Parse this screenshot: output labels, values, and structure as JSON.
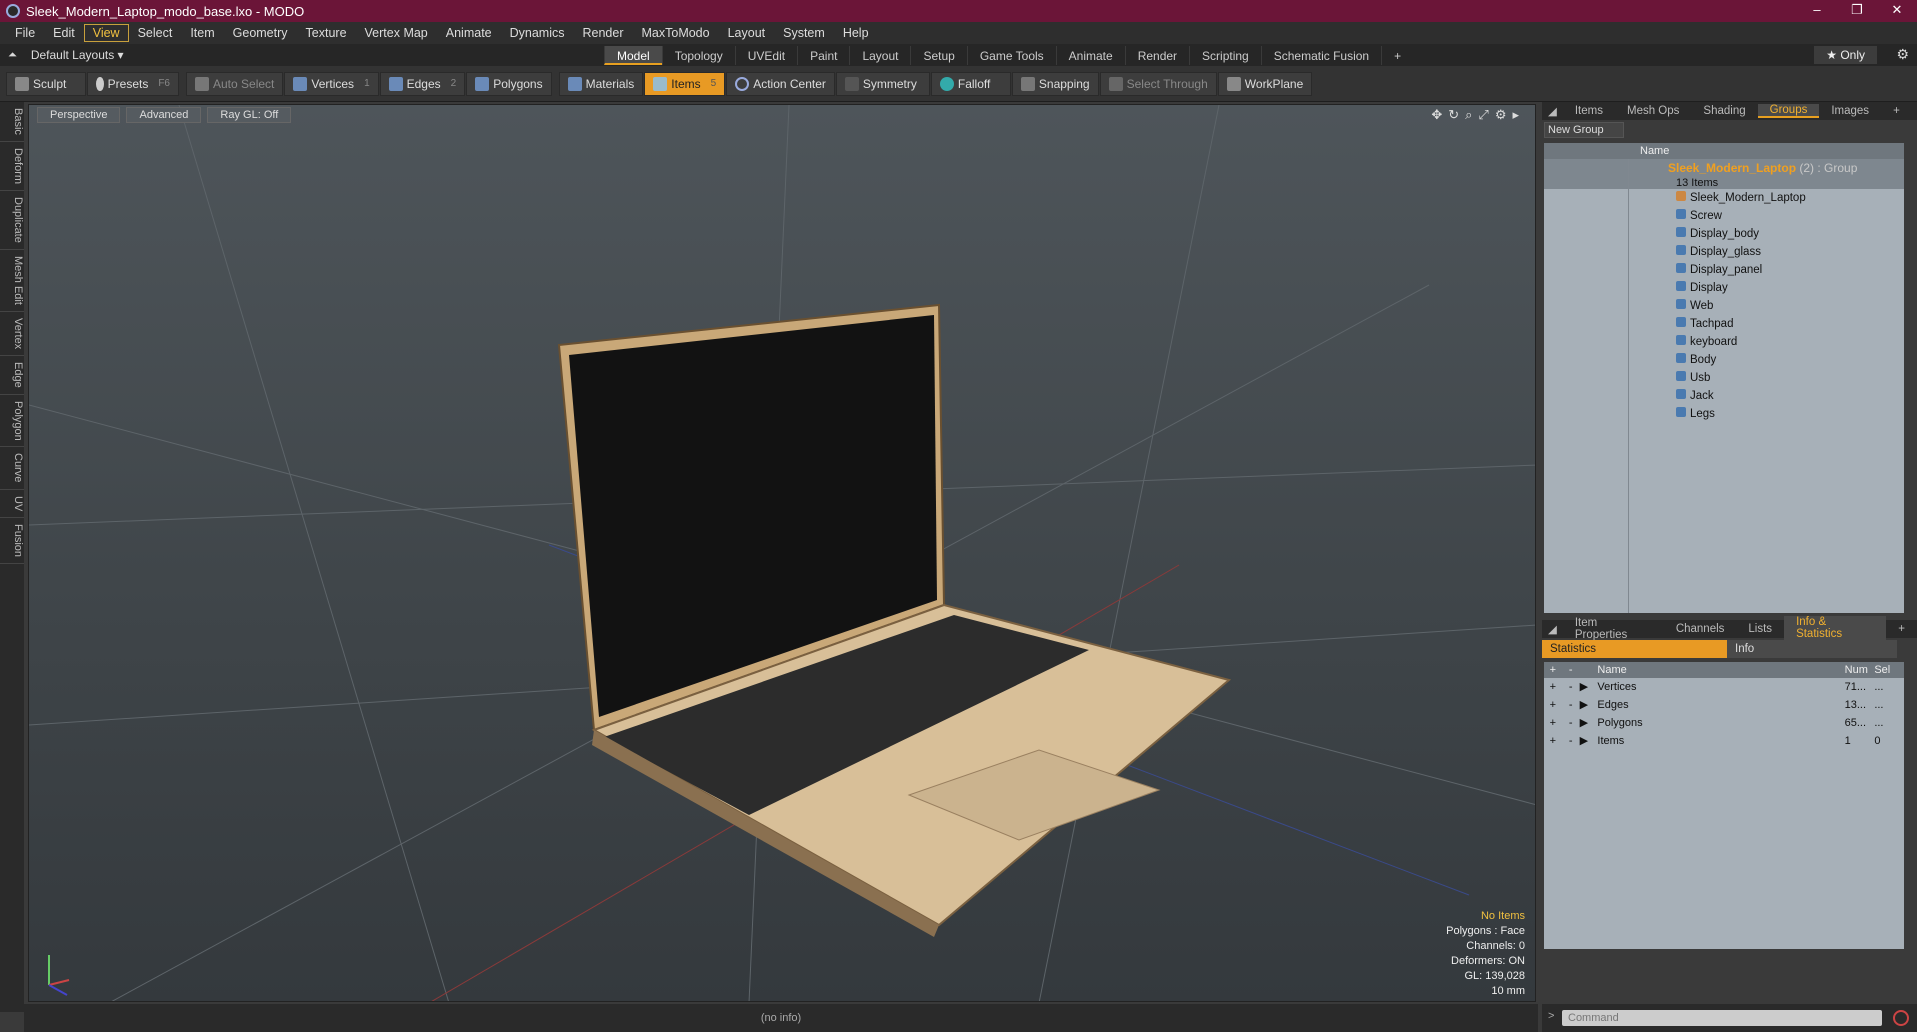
{
  "window": {
    "title": "Sleek_Modern_Laptop_modo_base.lxo - MODO",
    "controls": [
      "–",
      "❐",
      "✕"
    ]
  },
  "menu": [
    "File",
    "Edit",
    "View",
    "Select",
    "Item",
    "Geometry",
    "Texture",
    "Vertex Map",
    "Animate",
    "Dynamics",
    "Render",
    "MaxToModo",
    "Layout",
    "System",
    "Help"
  ],
  "menu_active": "View",
  "layout": {
    "name": "Default Layouts ▾",
    "tabs": [
      "Model",
      "Topology",
      "UVEdit",
      "Paint",
      "Layout",
      "Setup",
      "Game Tools",
      "Animate",
      "Render",
      "Scripting",
      "Schematic Fusion",
      "+"
    ],
    "active": "Model",
    "only": "★ Only"
  },
  "toolbar": {
    "sculpt": "Sculpt",
    "presets": "Presets",
    "presets_key": "F6",
    "auto_select": "Auto Select",
    "vertices": "Vertices",
    "vertices_key": "1",
    "edges": "Edges",
    "edges_key": "2",
    "polygons": "Polygons",
    "materials": "Materials",
    "items": "Items",
    "items_key": "5",
    "action_center": "Action Center",
    "symmetry": "Symmetry",
    "falloff": "Falloff",
    "snapping": "Snapping",
    "select_through": "Select Through",
    "workplane": "WorkPlane"
  },
  "left_tabs": [
    "Basic",
    "Deform",
    "Duplicate",
    "Mesh Edit",
    "Vertex",
    "Edge",
    "Polygon",
    "Curve",
    "UV",
    "Fusion"
  ],
  "viewport": {
    "view": "Perspective",
    "shading": "Advanced",
    "raygl": "Ray GL: Off",
    "stats": {
      "items": "No Items",
      "polygons": "Polygons : Face",
      "channels": "Channels: 0",
      "deformers": "Deformers: ON",
      "gl": "GL: 139,028",
      "scale": "10 mm"
    }
  },
  "status": "(no info)",
  "groups_panel": {
    "tabs": [
      "Items",
      "Mesh Ops",
      "Shading",
      "Groups",
      "Images",
      "+"
    ],
    "active": "Groups",
    "new_group": "New Group",
    "col_name": "Name",
    "group": {
      "name": "Sleek_Modern_Laptop",
      "suffix": "(2) : Group",
      "count": "13 Items"
    },
    "children": [
      "Sleek_Modern_Laptop",
      "Screw",
      "Display_body",
      "Display_glass",
      "Display_panel",
      "Display",
      "Web",
      "Tachpad",
      "keyboard",
      "Body",
      "Usb",
      "Jack",
      "Legs"
    ]
  },
  "info_panel": {
    "tabs": [
      "Item Properties",
      "Channels",
      "Lists",
      "Info & Statistics",
      "+"
    ],
    "active": "Info & Statistics",
    "sub_tabs": [
      "Statistics",
      "Info"
    ],
    "headers": [
      "Name",
      "Num",
      "Sel"
    ],
    "rows": [
      {
        "name": "Vertices",
        "num": "71...",
        "sel": "..."
      },
      {
        "name": "Edges",
        "num": "13...",
        "sel": "..."
      },
      {
        "name": "Polygons",
        "num": "65...",
        "sel": "..."
      },
      {
        "name": "Items",
        "num": "1",
        "sel": "0"
      }
    ]
  },
  "command": {
    "placeholder": "Command",
    "prompt": ">"
  }
}
